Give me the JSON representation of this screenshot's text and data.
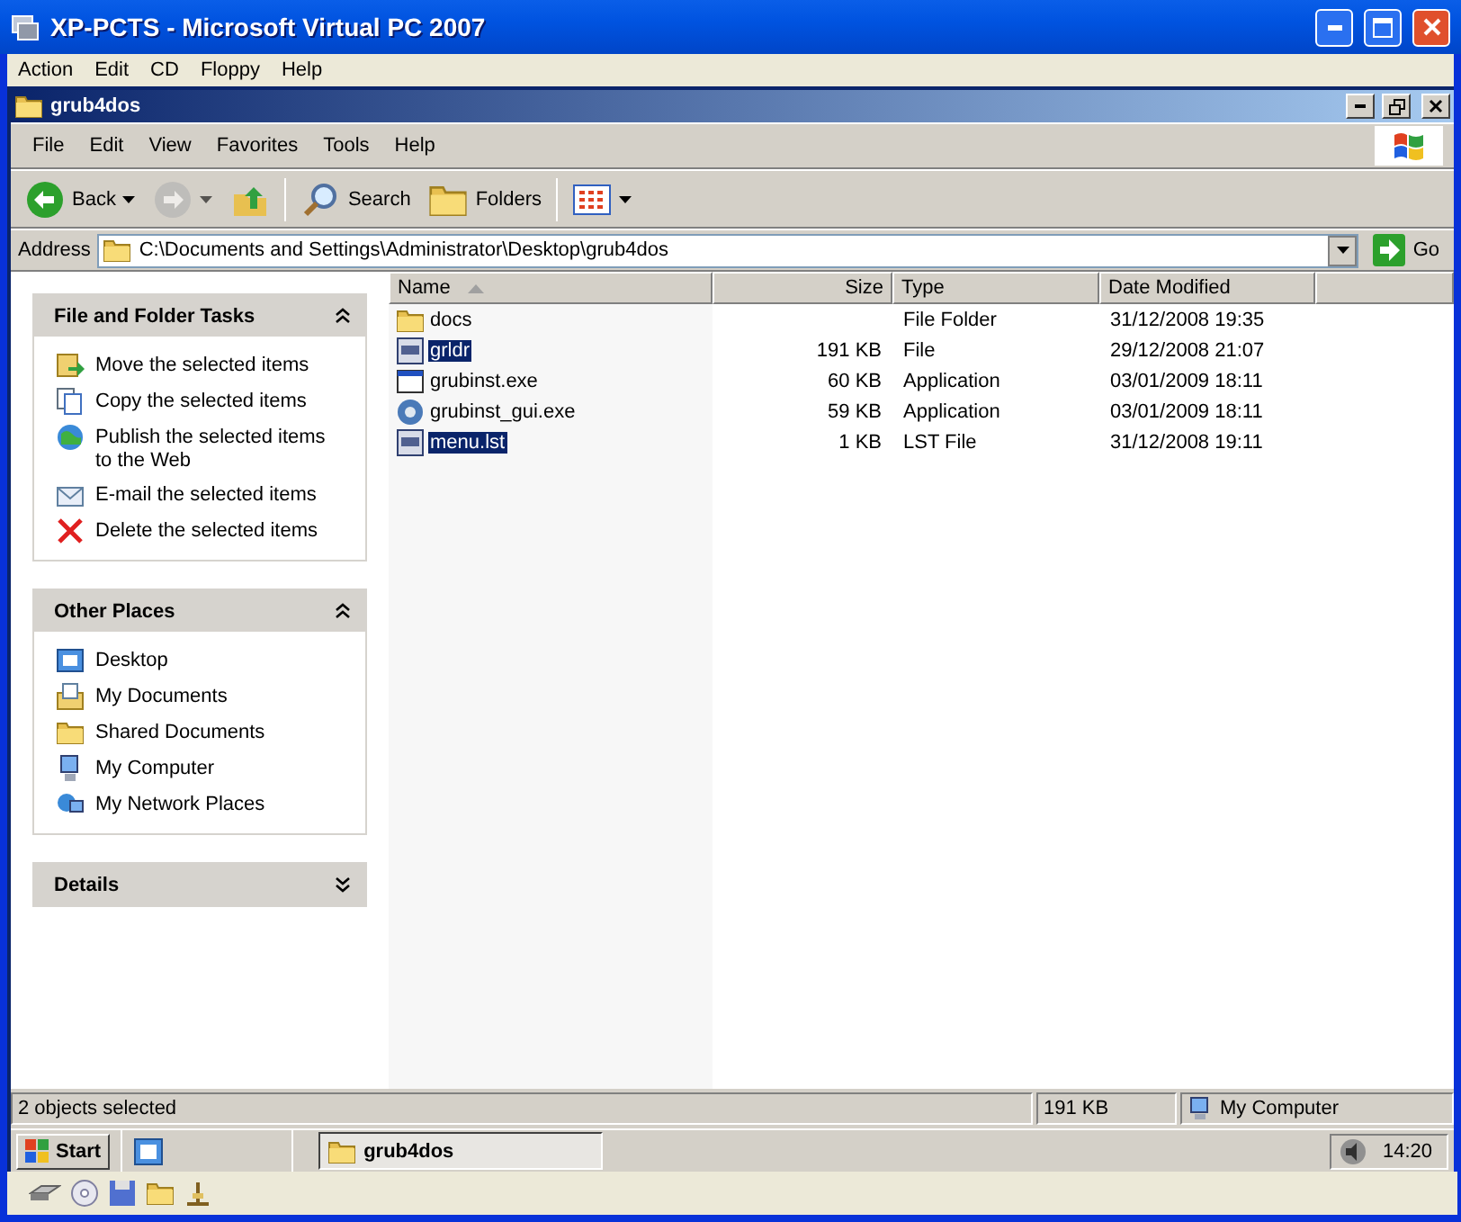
{
  "host_window": {
    "title": "XP-PCTS - Microsoft Virtual PC 2007",
    "menu": [
      "Action",
      "Edit",
      "CD",
      "Floppy",
      "Help"
    ]
  },
  "explorer": {
    "title": "grub4dos",
    "menu": [
      "File",
      "Edit",
      "View",
      "Favorites",
      "Tools",
      "Help"
    ],
    "toolbar": [
      {
        "kind": "back",
        "label": "Back",
        "disabled": false
      },
      {
        "kind": "forward",
        "disabled": true
      },
      {
        "kind": "up",
        "disabled": false
      },
      {
        "kind": "search",
        "label": "Search",
        "disabled": false
      },
      {
        "kind": "folders",
        "label": "Folders",
        "disabled": false
      },
      {
        "kind": "views",
        "disabled": false
      }
    ],
    "address": {
      "label": "Address",
      "value": "C:\\Documents and Settings\\Administrator\\Desktop\\grub4dos",
      "go": "Go"
    },
    "panels": [
      {
        "title": "File and Folder Tasks",
        "expanded": true,
        "items": [
          {
            "kind": "move",
            "label": "Move the selected items"
          },
          {
            "kind": "copy",
            "label": "Copy the selected items"
          },
          {
            "kind": "publish",
            "label": "Publish the selected items to the Web"
          },
          {
            "kind": "email",
            "label": "E-mail the selected items"
          },
          {
            "kind": "delete",
            "label": "Delete the selected items"
          }
        ]
      },
      {
        "title": "Other Places",
        "expanded": true,
        "items": [
          {
            "kind": "desktop",
            "label": "Desktop"
          },
          {
            "kind": "documents",
            "label": "My Documents"
          },
          {
            "kind": "folder",
            "label": "Shared Documents"
          },
          {
            "kind": "computer",
            "label": "My Computer"
          },
          {
            "kind": "network",
            "label": "My Network Places"
          }
        ]
      },
      {
        "title": "Details",
        "expanded": false
      }
    ],
    "columns": [
      "Name",
      "Size",
      "Type",
      "Date Modified"
    ],
    "files": [
      {
        "kind": "folder",
        "name": "docs",
        "type": "File Folder",
        "date": "31/12/2008 19:35",
        "selected": false
      },
      {
        "kind": "file",
        "name": "grldr",
        "size": "191 KB",
        "type": "File",
        "date": "29/12/2008 21:07",
        "selected": true
      },
      {
        "kind": "app",
        "name": "grubinst.exe",
        "size": "60 KB",
        "type": "Application",
        "date": "03/01/2009 18:11",
        "selected": false
      },
      {
        "kind": "disc",
        "name": "grubinst_gui.exe",
        "size": "59 KB",
        "type": "Application",
        "date": "03/01/2009 18:11",
        "selected": false
      },
      {
        "kind": "file",
        "name": "menu.lst",
        "size": "1 KB",
        "type": "LST File",
        "date": "31/12/2008 19:11",
        "selected": true
      }
    ],
    "status_bar": [
      "2 objects selected",
      "191 KB",
      "My Computer"
    ]
  },
  "taskbar": {
    "start": "Start",
    "task": "grub4dos",
    "clock": "14:20"
  }
}
